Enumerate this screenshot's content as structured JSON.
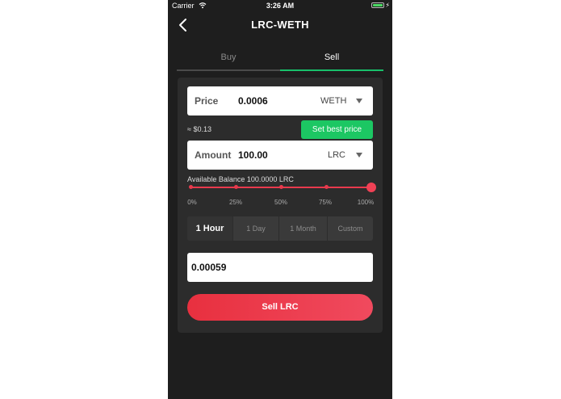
{
  "status_bar": {
    "carrier": "Carrier",
    "time": "3:26 AM"
  },
  "nav": {
    "title": "LRC-WETH"
  },
  "tabs": [
    {
      "label": "Buy"
    },
    {
      "label": "Sell"
    }
  ],
  "price_field": {
    "label": "Price",
    "value": "0.0006",
    "unit": "WETH"
  },
  "usd_estimate": "≈ $0.13",
  "best_price_button": "Set best price",
  "amount_field": {
    "label": "Amount",
    "value": "100.00",
    "unit": "LRC"
  },
  "available_balance": "Available Balance 100.0000 LRC",
  "slider": {
    "value_percent": 100,
    "labels": [
      "0%",
      "25%",
      "50%",
      "75%",
      "100%"
    ]
  },
  "expiry_options": [
    {
      "label": "1 Hour",
      "selected": true
    },
    {
      "label": "1 Day",
      "selected": false
    },
    {
      "label": "1 Month",
      "selected": false
    },
    {
      "label": "Custom",
      "selected": false
    }
  ],
  "total_input": {
    "value": "0.00059"
  },
  "submit_button": "Sell LRC",
  "colors": {
    "accent_green": "#18c06a",
    "sell_red": "#e8303f",
    "background": "#1e1e1e",
    "card": "#2c2c2c"
  }
}
